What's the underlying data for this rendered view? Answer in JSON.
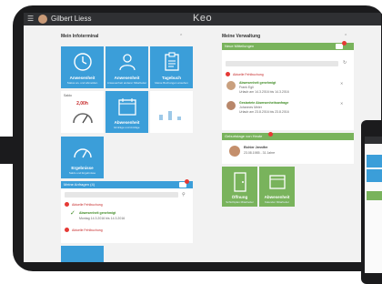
{
  "header": {
    "username": "Gilbert Liess",
    "brand": "Keo"
  },
  "left_column": {
    "title": "Mein Infoterminal",
    "tiles": [
      {
        "label": "Anwesenheit",
        "sub": "Status an- und abmelden",
        "icon": "clock-icon"
      },
      {
        "label": "Anwesenheit",
        "sub": "Anwesenheit anderer Mitarbeiter",
        "icon": "people-icon"
      },
      {
        "label": "Tagebuch",
        "sub": "Meine Buchungen ansehen",
        "icon": "clipboard-icon"
      },
      {
        "label": "Saldo",
        "value": "2,00h",
        "icon": "gauge-icon"
      },
      {
        "label": "Abwesenheit",
        "sub": "Einträge und Anträge",
        "icon": "calendar-icon"
      },
      {
        "label": "Ergebnisse",
        "sub": "Saldo und Ergebnisse",
        "icon": "speedometer-icon"
      }
    ]
  },
  "requests_panel": {
    "title": "Meine Anfragen (4)",
    "items": [
      {
        "text": "Aktuelle Fehlbuchung"
      },
      {
        "text": "Abwesenheit genehmigt",
        "detail": "Montag 14.3.2016 bis 14.3.2016"
      },
      {
        "text": "Aktuelle Fehlbuchung"
      }
    ]
  },
  "right_column": {
    "title": "Meine Verwaltung",
    "panel_title": "Neue Mitteilungen",
    "notifications": [
      {
        "text": "Aktuelle Fehlbuchung"
      },
      {
        "title": "Abwesenheit genehmigt",
        "name": "Frank Egli",
        "date": "Urlaub am 14.3.2016 bis 14.3.2016"
      },
      {
        "title": "Gestartete Abwesenheitsanfrage",
        "name": "Johannes Meier",
        "date": "Urlaub am 23.8.2016 bis 23.8.2016"
      }
    ],
    "birthday_panel_title": "Geburtstage von Heute",
    "birthday": {
      "name": "Eichler Jennifer",
      "detail": "23.08.1985 - 31 Jahre"
    },
    "tiles": [
      {
        "label": "Öffnung",
        "sub": "Schichtplan Mitarbeiter",
        "icon": "door-icon"
      },
      {
        "label": "Abwesenheit",
        "sub": "Kalender Mitarbeiter",
        "icon": "calendar-icon"
      }
    ]
  },
  "colors": {
    "blue": "#3b9ed9",
    "green": "#79b35c",
    "topbar": "#2f3033",
    "badge": "#e53935"
  }
}
